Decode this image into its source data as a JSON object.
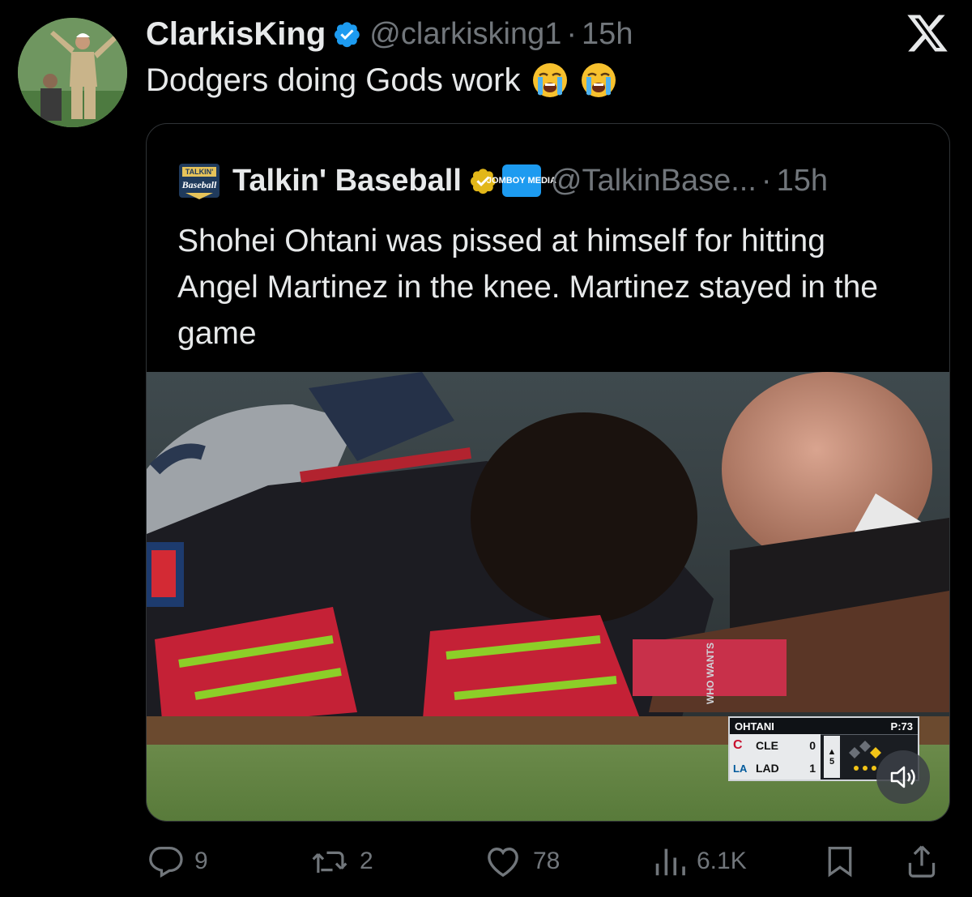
{
  "author": {
    "display_name": "ClarkisKing",
    "handle": "@clarkisking1",
    "separator": "·",
    "time": "15h",
    "verified": true
  },
  "tweet": {
    "text": "Dodgers doing Gods work",
    "emojis": [
      "loudly-crying-face",
      "loudly-crying-face"
    ]
  },
  "quote": {
    "logo_text_top": "TALKIN'",
    "logo_text_mid": "Baseball",
    "display_name": "Talkin' Baseball",
    "affiliate_badge": "JOMBOY MEDIA",
    "handle": "@TalkinBase...",
    "separator": "·",
    "time": "15h",
    "text": "Shohei Ohtani was pissed at himself for hitting Angel Martinez in the knee. Martinez stayed in the game",
    "media": {
      "wall_text": "WHO WANTS",
      "scorebug": {
        "batter": "OHTANI",
        "pitch_count": "P:73",
        "teams": [
          {
            "logo": "C",
            "abbr": "CLE",
            "score": "0"
          },
          {
            "logo": "LA",
            "abbr": "LAD",
            "score": "1"
          }
        ],
        "inning": "5",
        "inning_arrow": "▲"
      }
    }
  },
  "actions": {
    "replies": "9",
    "reposts": "2",
    "likes": "78",
    "views": "6.1K"
  },
  "colors": {
    "background": "#000000",
    "text": "#e7e9ea",
    "muted": "#71767b",
    "verified_blue": "#1d9bf0",
    "verified_gold": "#e2b719",
    "border": "#2f3336"
  }
}
